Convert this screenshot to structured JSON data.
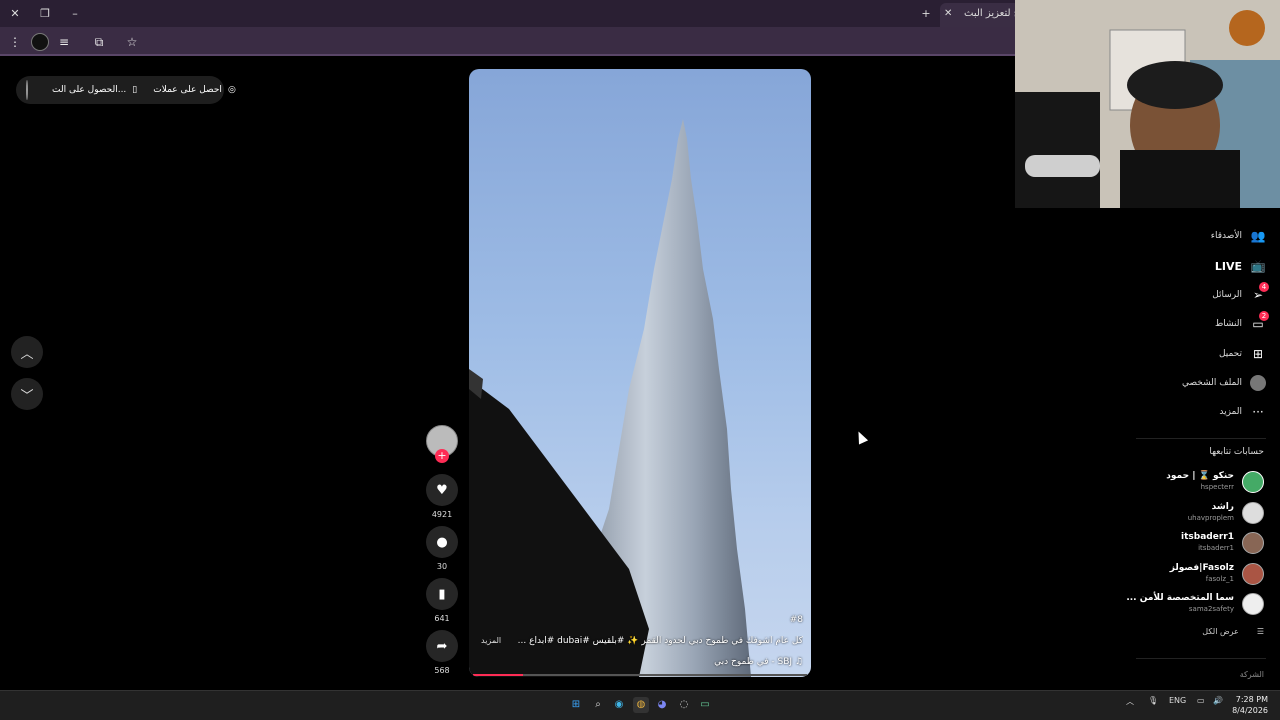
{
  "browser": {
    "tab_title": "برنامج لتعزيز البث...",
    "icons": [
      "close-icon",
      "restore-icon",
      "minimize-icon",
      "new-tab-icon",
      "tab-close-icon"
    ],
    "toolbar_icons": [
      "menu-dots-icon",
      "profile-icon",
      "playlist-icon",
      "extensions-icon",
      "star-icon"
    ]
  },
  "coins": {
    "get_coins_label": "احصل على عملات",
    "get_app_label": "الحصول على الت..."
  },
  "video": {
    "caption_tag": "#8",
    "caption": "كل عام اشوفك في طموح دبي لحدود القمر ✨ #بلقيس #dubai #ابداع ...",
    "more_label": "المزيد",
    "music": "♫  SBJ - في طموح دبي",
    "progress": 0.15
  },
  "actions": {
    "likes": "4921",
    "comments": "30",
    "saves": "641",
    "shares": "568"
  },
  "sidebar": {
    "nav": [
      {
        "label": "الأصدقاء",
        "icon": "friends-icon"
      },
      {
        "label": "LIVE",
        "icon": "live-icon"
      },
      {
        "label": "الرسائل",
        "icon": "messages-icon",
        "badge": "4"
      },
      {
        "label": "النشاط",
        "icon": "activity-icon",
        "badge": "2"
      },
      {
        "label": "تحميل",
        "icon": "upload-icon"
      },
      {
        "label": "الملف الشخصي",
        "icon": "profile-avatar"
      },
      {
        "label": "المزيد",
        "icon": "more-icon"
      }
    ],
    "following_heading": "حسابات تتابعها",
    "accounts": [
      {
        "name": "حنكو ⌛ | حمود",
        "handle": "hspecterr"
      },
      {
        "name": "راشد",
        "handle": "uhavproplem"
      },
      {
        "name": "itsbaderr1",
        "handle": "itsbaderr1"
      },
      {
        "name": "Fasolz|فصولز",
        "handle": "fasolz_1"
      },
      {
        "name": "سما المتخصصة للأمن ...",
        "handle": "sama2safety"
      }
    ],
    "see_all": "عرض الكل",
    "company": "الشركة"
  },
  "taskbar": {
    "lang": "ENG",
    "time": "7:28 PM",
    "date": "8/4/2026"
  },
  "colors": {
    "accent": "#fe2c55",
    "chrome": "#3a2c44"
  }
}
